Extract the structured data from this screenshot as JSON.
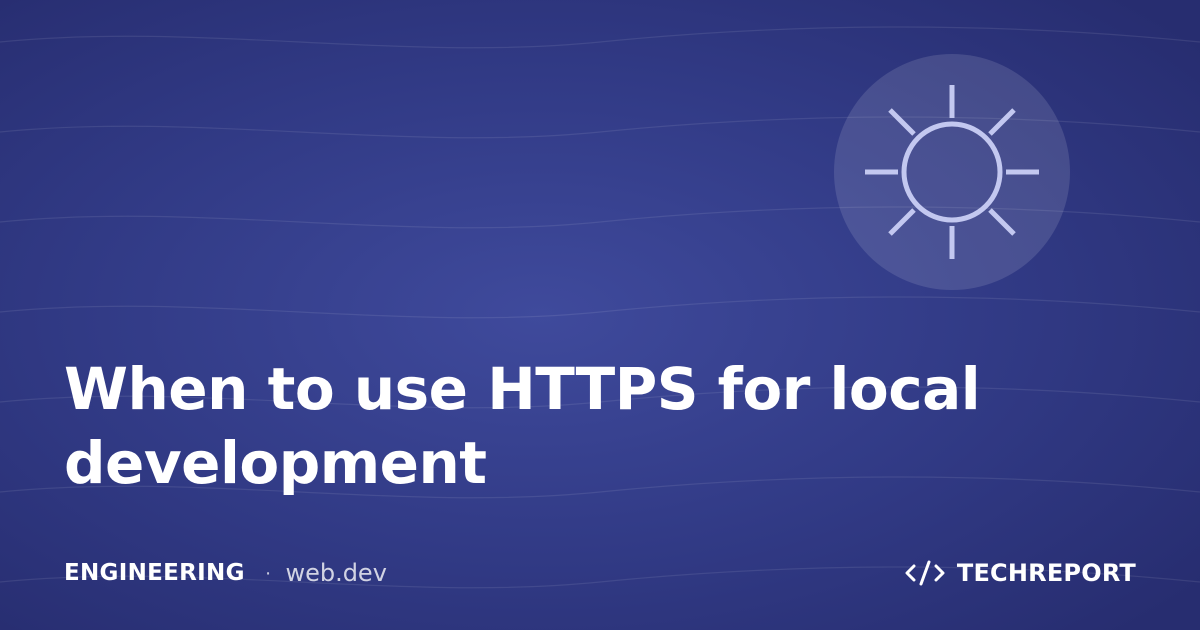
{
  "headline": "When to use HTTPS for local development",
  "footer": {
    "category": "ENGINEERING",
    "separator": "·",
    "source": "web.dev",
    "brand": "TECHREPORT"
  },
  "colors": {
    "background": "#313a85",
    "accent": "#c3c8f0",
    "text": "#ffffff"
  },
  "icons": {
    "emblem": "sun-icon",
    "brand": "code-icon"
  }
}
